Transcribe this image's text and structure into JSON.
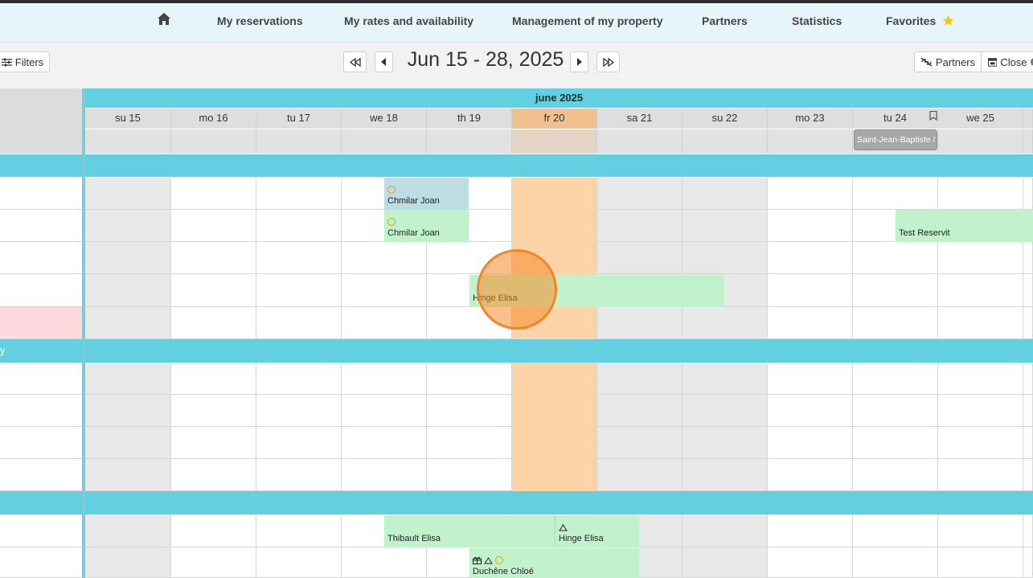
{
  "nav": {
    "home_icon": "home-icon",
    "items": [
      "My reservations",
      "My rates and availability",
      "Management of my property",
      "Partners",
      "Statistics",
      "Favorites"
    ],
    "favorites_icon": "star-icon"
  },
  "toolbar": {
    "filters_label": "Filters",
    "range_title": "Jun 15 - 28, 2025",
    "partners_label": "Partners",
    "close_label": "Close"
  },
  "calendar": {
    "month_label": "june 2025",
    "days": [
      "su 15",
      "mo 16",
      "tu 17",
      "we 18",
      "th 19",
      "fr 20",
      "sa 21",
      "su 22",
      "mo 23",
      "tu 24",
      "we 25"
    ],
    "today": "fr 20",
    "holiday_label": "Saint-Jean-Baptiste / Fête nationale",
    "left_partial_label": "y",
    "reservations": [
      {
        "guest": "Chmilar Joan",
        "status": "pending"
      },
      {
        "guest": "Chmilar Joan",
        "status": "confirmed"
      },
      {
        "guest": "Test Reservit"
      },
      {
        "guest": "Hinge Elisa"
      },
      {
        "guest": "Thibault Elisa"
      },
      {
        "guest": "Hinge Elisa"
      },
      {
        "guest": "Duchêne Chloé"
      }
    ]
  },
  "colors": {
    "accent": "#62d0e0",
    "today": "#fdd3a8",
    "reservation_green": "#c2f2cc",
    "reservation_blue": "#bcdde3",
    "blocked": "#ffd9de",
    "star": "#f7c21a"
  }
}
